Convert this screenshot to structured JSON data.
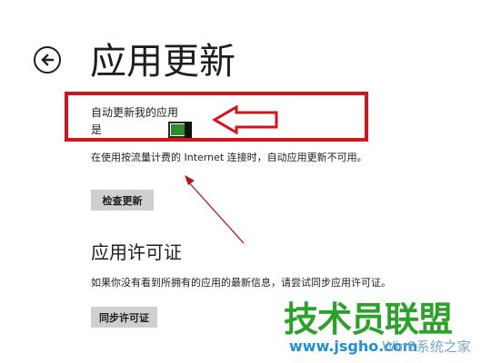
{
  "header": {
    "title": "应用更新"
  },
  "auto_update": {
    "label": "自动更新我的应用",
    "state_text": "是",
    "on": true,
    "accent_color": "#2e8b2e"
  },
  "metered_note": "在使用按流量计费的 Internet 连接时，自动应用更新不可用。",
  "check_updates_button": "检查更新",
  "license": {
    "title": "应用许可证",
    "note": "如果你没有看到所拥有的应用的最新信息，请尝试同步应用许可证。",
    "sync_button": "同步许可证"
  },
  "annotation": {
    "color": "#d3141c"
  },
  "watermark": {
    "main": "技术员联盟",
    "url": "www.jsgho.com",
    "site": "Win8系统之家",
    "main_color": "#2da02d",
    "url_color": "#1f8fd6"
  }
}
